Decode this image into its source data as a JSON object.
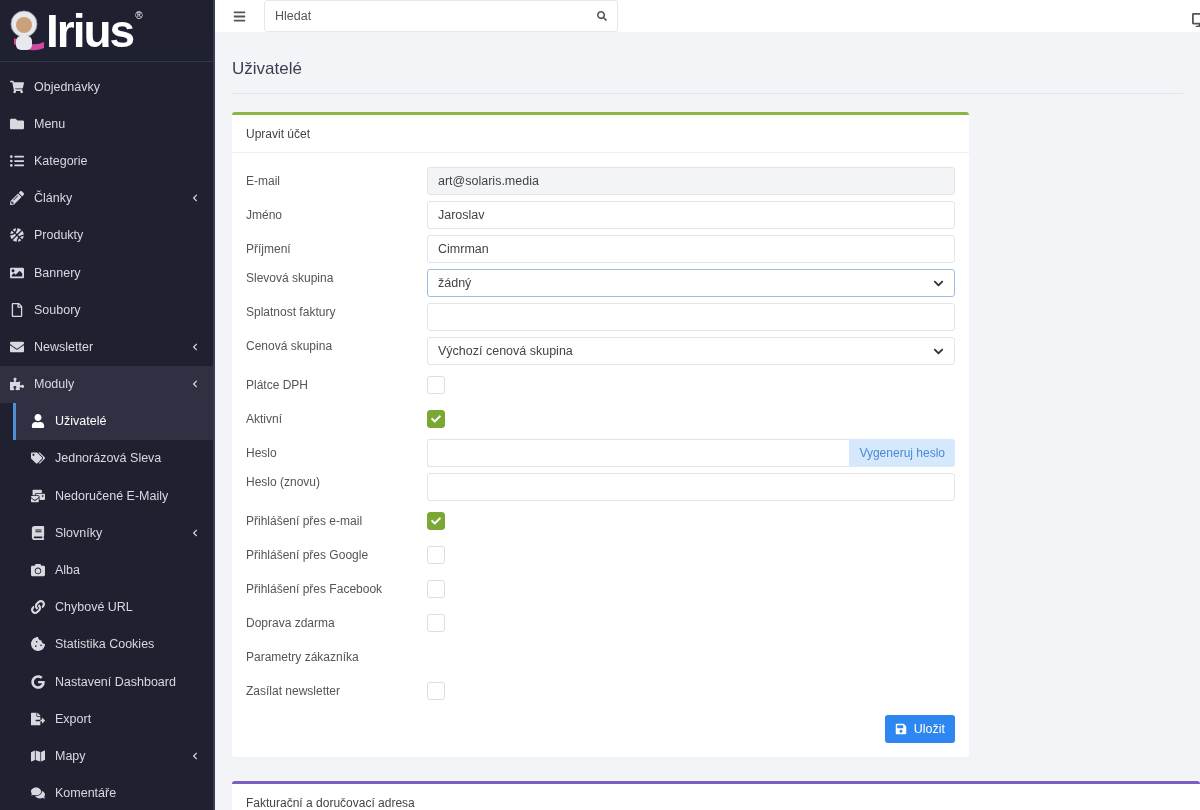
{
  "logo": {
    "text": "Irius",
    "mark": "®"
  },
  "sidebar": {
    "items": [
      {
        "label": "Objednávky",
        "selected": false,
        "has_submenu": false
      },
      {
        "label": "Menu",
        "selected": false,
        "has_submenu": false
      },
      {
        "label": "Kategorie",
        "selected": false,
        "has_submenu": false
      },
      {
        "label": "Články",
        "selected": false,
        "has_submenu": true
      },
      {
        "label": "Produkty",
        "selected": false,
        "has_submenu": false
      },
      {
        "label": "Bannery",
        "selected": false,
        "has_submenu": false
      },
      {
        "label": "Soubory",
        "selected": false,
        "has_submenu": false
      },
      {
        "label": "Newsletter",
        "selected": false,
        "has_submenu": true
      },
      {
        "label": "Moduly",
        "selected": true,
        "has_submenu": true,
        "children": [
          {
            "label": "Uživatelé",
            "selected": true,
            "has_submenu": false
          },
          {
            "label": "Jednorázová Sleva",
            "selected": false,
            "has_submenu": false
          },
          {
            "label": "Nedoručené E-Maily",
            "selected": false,
            "has_submenu": false
          },
          {
            "label": "Slovníky",
            "selected": false,
            "has_submenu": true
          },
          {
            "label": "Alba",
            "selected": false,
            "has_submenu": false
          },
          {
            "label": "Chybové URL",
            "selected": false,
            "has_submenu": false
          },
          {
            "label": "Statistika Cookies",
            "selected": false,
            "has_submenu": false
          },
          {
            "label": "Nastavení Dashboard",
            "selected": false,
            "has_submenu": false
          },
          {
            "label": "Export",
            "selected": false,
            "has_submenu": false
          },
          {
            "label": "Mapy",
            "selected": false,
            "has_submenu": true
          },
          {
            "label": "Komentáře",
            "selected": false,
            "has_submenu": false
          }
        ]
      }
    ]
  },
  "search": {
    "placeholder": "Hledat"
  },
  "page_title": "Uživatelé",
  "form_card": {
    "title": "Upravit účet",
    "fields": [
      {
        "kind": "input",
        "label": "E-mail",
        "value": "art@solaris.media",
        "disabled": true,
        "focused": false
      },
      {
        "kind": "input",
        "label": "Jméno",
        "value": "Jaroslav",
        "disabled": false,
        "focused": false
      },
      {
        "kind": "input",
        "label": "Příjmení",
        "value": "Cimrman",
        "disabled": false,
        "focused": false
      },
      {
        "kind": "select",
        "label": "Slevová skupina",
        "value": "žádný",
        "disabled": false,
        "focused": true
      },
      {
        "kind": "input",
        "label": "Splatnost faktury",
        "disabled": false,
        "focused": false
      },
      {
        "kind": "select",
        "label": "Cenová skupina",
        "value": "Výchozí cenová skupina",
        "disabled": false,
        "focused": false
      },
      {
        "kind": "checkbox",
        "label": "Plátce DPH",
        "checked": false
      },
      {
        "kind": "checkbox",
        "label": "Aktivní",
        "checked": true
      },
      {
        "kind": "password",
        "label": "Heslo",
        "button": "Vygeneruj heslo"
      },
      {
        "kind": "input",
        "label": "Heslo (znovu)",
        "disabled": false,
        "focused": false
      },
      {
        "kind": "checkbox",
        "label": "Přihlášení přes e-mail",
        "checked": true
      },
      {
        "kind": "checkbox",
        "label": "Přihlášení přes Google",
        "checked": false
      },
      {
        "kind": "checkbox",
        "label": "Přihlášení přes Facebook",
        "checked": false
      },
      {
        "kind": "checkbox",
        "label": "Doprava zdarma",
        "checked": false
      },
      {
        "kind": "label",
        "label": "Parametry zákazníka"
      },
      {
        "kind": "checkbox",
        "label": "Zasílat newsletter",
        "checked": false
      }
    ],
    "save_button": "Uložit"
  },
  "address_card": {
    "title": "Fakturační a doručovací adresa"
  }
}
